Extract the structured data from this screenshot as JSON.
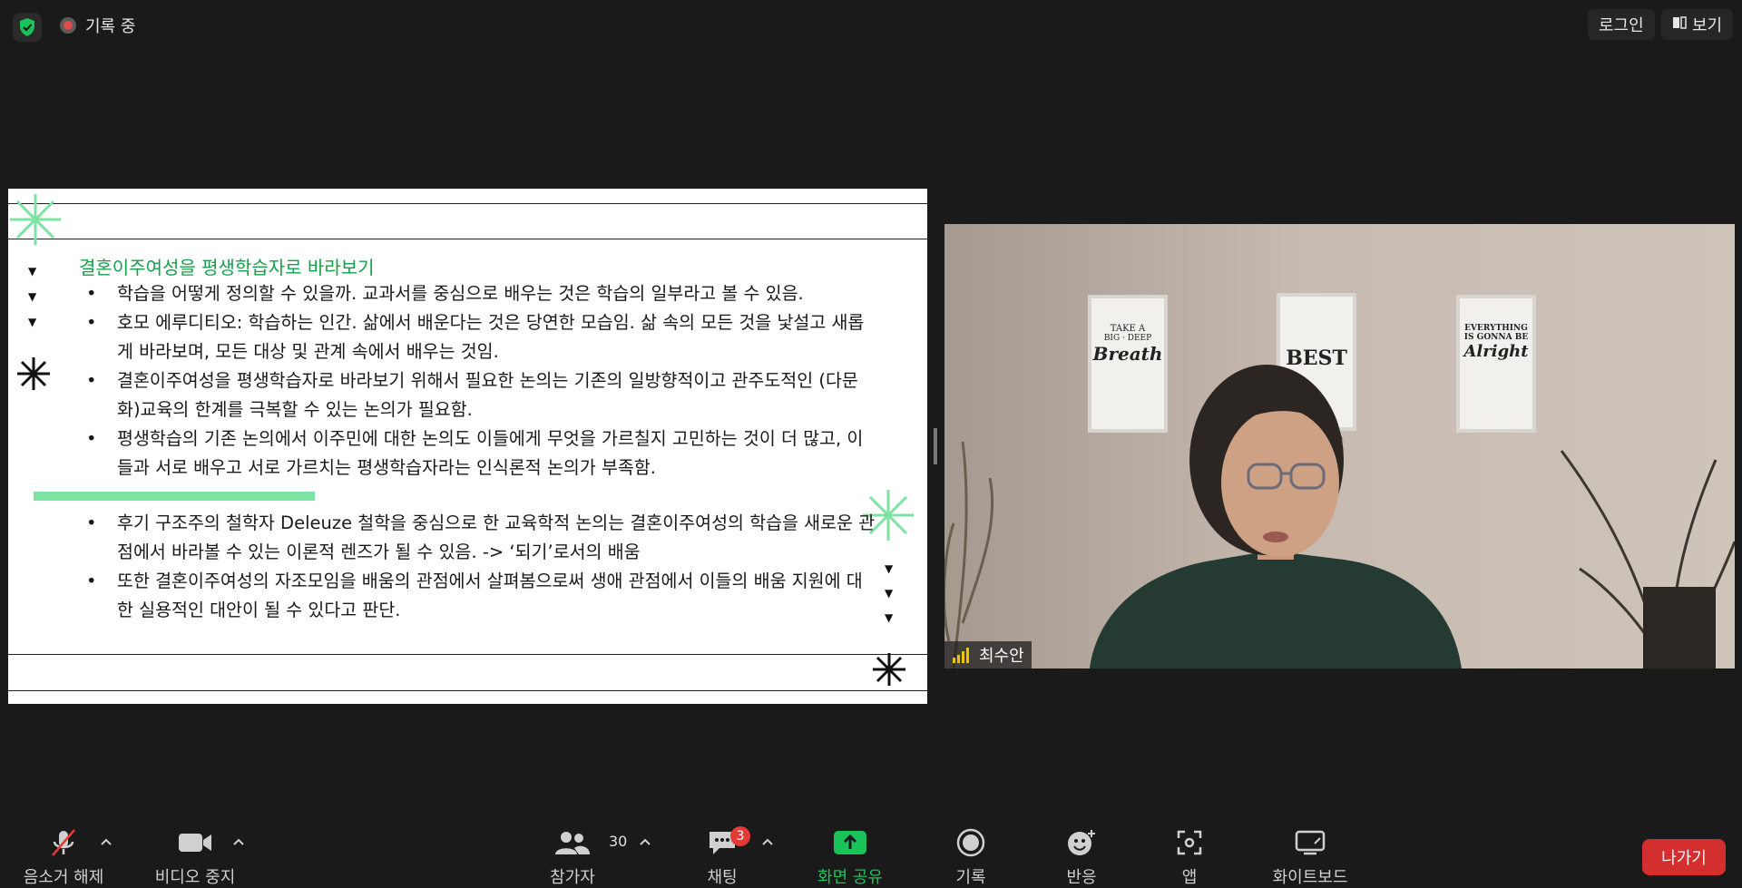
{
  "topbar": {
    "recording_label": "기록 중",
    "login_label": "로그인",
    "view_label": "보기"
  },
  "slide": {
    "title": "결혼이주여성을 평생학습자로 바라보기",
    "bullets_top": [
      "학습을 어떻게 정의할 수 있을까. 교과서를 중심으로 배우는 것은 학습의 일부라고 볼 수 있음.",
      "호모 에루디티오: 학습하는 인간. 삶에서 배운다는 것은 당연한 모습임. 삶 속의 모든 것을 낯설고 새롭게 바라보며, 모든 대상 및 관계 속에서 배우는 것임.",
      "결혼이주여성을 평생학습자로 바라보기 위해서 필요한 논의는 기존의 일방향적이고 관주도적인 (다문화)교육의 한계를 극복할 수 있는 논의가 필요함.",
      " 평생학습의 기존 논의에서 이주민에 대한 논의도 이들에게 무엇을 가르칠지 고민하는 것이 더 많고, 이들과 서로 배우고 서로 가르치는 평생학습자라는 인식론적 논의가 부족함."
    ],
    "bullets_bottom": [
      "후기 구조주의 철학자 Deleuze 철학을 중심으로 한 교육학적 논의는 결혼이주여성의 학습을 새로운 관점에서 바라볼 수 있는 이론적 렌즈가 될 수 있음. -> ‘되기’로서의 배움",
      "또한 결혼이주여성의 자조모임을 배움의 관점에서 살펴봄으로써 생애 관점에서 이들의 배움 지원에 대한 실용적인 대안이 될 수 있다고 판단."
    ]
  },
  "video": {
    "participant_name": "최수안",
    "poster_1": [
      "TAKE A",
      "BIG · DEEP",
      "Breath"
    ],
    "poster_2": [
      "BEST"
    ],
    "poster_3": [
      "EVERYTHING",
      "IS GONNA BE",
      "Alright"
    ]
  },
  "toolbar": {
    "unmute_label": "음소거 해제",
    "stop_video_label": "비디오 중지",
    "participants_label": "참가자",
    "participants_count": "30",
    "chat_label": "채팅",
    "chat_badge": "3",
    "share_label": "화면 공유",
    "record_label": "기록",
    "reactions_label": "반응",
    "apps_label": "앱",
    "whiteboard_label": "화이트보드",
    "leave_label": "나가기"
  },
  "colors": {
    "accent_green": "#19c35a",
    "slide_title_green": "#14a04a",
    "leave_red": "#d32f2f",
    "badge_red": "#e53935"
  }
}
